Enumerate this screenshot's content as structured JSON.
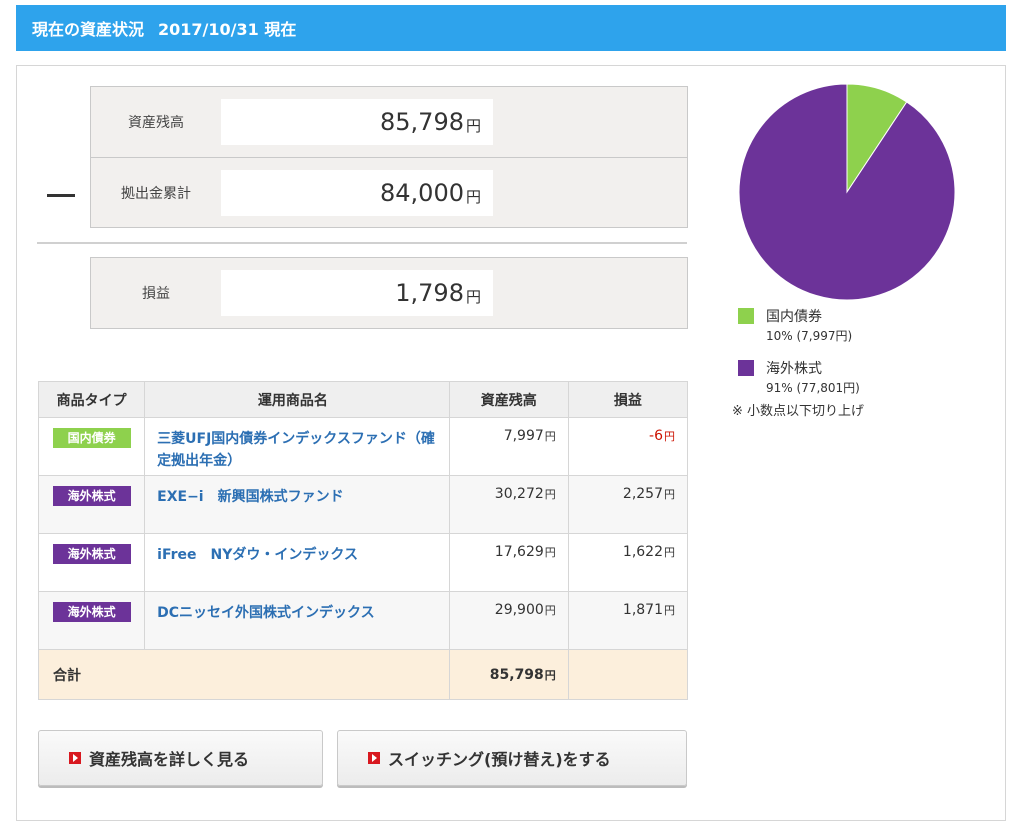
{
  "header": {
    "title": "現在の資産状況",
    "date": "2017/10/31 現在"
  },
  "summary": {
    "balance": {
      "label": "資産残高",
      "value": "85,798",
      "unit": "円"
    },
    "contribution": {
      "label": "拠出金累計",
      "value": "84,000",
      "unit": "円"
    },
    "profit": {
      "label": "損益",
      "value": "1,798",
      "unit": "円"
    }
  },
  "table": {
    "headers": [
      "商品タイプ",
      "運用商品名",
      "資産残高",
      "損益"
    ],
    "rows": [
      {
        "type": "国内債券",
        "name": "三菱UFJ国内債券インデックスファンド（確定拠出年金）",
        "balance": "7,997",
        "profit": "-6"
      },
      {
        "type": "海外株式",
        "name": "EXE−i　新興国株式ファンド",
        "balance": "30,272",
        "profit": "2,257"
      },
      {
        "type": "海外株式",
        "name": "iFree　NYダウ・インデックス",
        "balance": "17,629",
        "profit": "1,622"
      },
      {
        "type": "海外株式",
        "name": "DCニッセイ外国株式インデックス",
        "balance": "29,900",
        "profit": "1,871"
      }
    ],
    "total": {
      "label": "合計",
      "balance": "85,798"
    },
    "unit": "円"
  },
  "buttons": {
    "detail": "資産残高を詳しく見る",
    "switching": "スイッチング(預け替え)をする"
  },
  "chart_data": {
    "type": "pie",
    "categories": [
      "国内債券",
      "海外株式"
    ],
    "values": [
      7997,
      77801
    ],
    "labels": [
      "10% (7,997円)",
      "91% (77,801円)"
    ],
    "colors": [
      "#8ed14d",
      "#6c3399"
    ],
    "legend": "bottom"
  },
  "note": "※ 小数点以下切り上げ"
}
